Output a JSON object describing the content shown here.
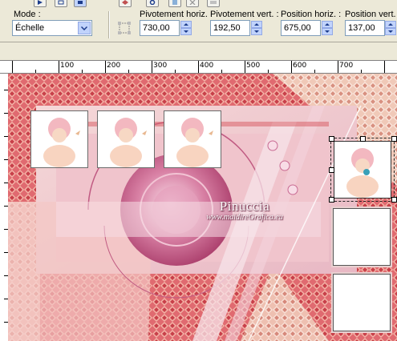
{
  "toolbar": {
    "mode_label": "Mode :",
    "mode_value": "Échelle",
    "pivot_h_label": "Pivotement horiz. :",
    "pivot_h_value": "730,00",
    "pivot_v_label": "Pivotement vert. :",
    "pivot_v_value": "192,50",
    "pos_h_label": "Position horiz. :",
    "pos_h_value": "675,00",
    "pos_v_label": "Position vert. :",
    "pos_v_value": "137,00"
  },
  "ruler": {
    "marks": [
      "100",
      "200",
      "300",
      "400",
      "500",
      "600",
      "700"
    ]
  },
  "canvas": {
    "watermark_title": "Pinuccia",
    "watermark_url": "www.maidireGrafica.eu"
  },
  "colors": {
    "canvas_pink": "#e8a0a8",
    "accent_red": "#d05458",
    "magenta": "#b0406a",
    "toolbar_bg": "#ece9d8"
  }
}
